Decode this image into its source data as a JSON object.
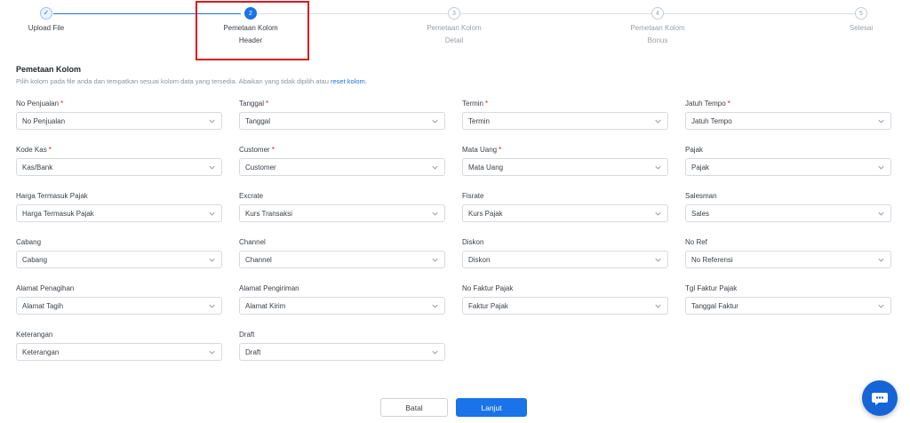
{
  "stepper": {
    "steps": [
      {
        "number": "✓",
        "line1": "Upload File",
        "line2": "",
        "state": "done"
      },
      {
        "number": "2",
        "line1": "Pemetaan Kolom",
        "line2": "Header",
        "state": "active"
      },
      {
        "number": "3",
        "line1": "Pemetaan Kolom",
        "line2": "Detail",
        "state": "todo"
      },
      {
        "number": "4",
        "line1": "Pemetaan Kolom",
        "line2": "Bonus",
        "state": "todo"
      },
      {
        "number": "5",
        "line1": "Selesai",
        "line2": "",
        "state": "todo"
      }
    ]
  },
  "section": {
    "title": "Pemetaan Kolom",
    "description": "Pilih kolom pada file anda dan tempatkan sesuai kolom data yang tersedia. Abaikan yang tidak dipilih atau",
    "reset_link": "reset kolom."
  },
  "fields": [
    {
      "label": "No Penjualan",
      "required": "*",
      "value": "No Penjualan"
    },
    {
      "label": "Tanggal",
      "required": "*",
      "value": "Tanggal"
    },
    {
      "label": "Termin",
      "required": "*",
      "value": "Termin"
    },
    {
      "label": "Jatuh Tempo",
      "required": "*",
      "value": "Jatuh Tempo"
    },
    {
      "label": "Kode Kas",
      "required": "*",
      "value": "Kas/Bank"
    },
    {
      "label": "Customer",
      "required": "*",
      "value": "Customer"
    },
    {
      "label": "Mata Uang",
      "required": "*",
      "value": "Mata Uang"
    },
    {
      "label": "Pajak",
      "required": "",
      "value": "Pajak"
    },
    {
      "label": "Harga Termasuk Pajak",
      "required": "",
      "value": "Harga Termasuk Pajak"
    },
    {
      "label": "Excrate",
      "required": "",
      "value": "Kurs Transaksi"
    },
    {
      "label": "Fisrate",
      "required": "",
      "value": "Kurs Pajak"
    },
    {
      "label": "Salesman",
      "required": "",
      "value": "Sales"
    },
    {
      "label": "Cabang",
      "required": "",
      "value": "Cabang"
    },
    {
      "label": "Channel",
      "required": "",
      "value": "Channel"
    },
    {
      "label": "Diskon",
      "required": "",
      "value": "Diskon"
    },
    {
      "label": "No Ref",
      "required": "",
      "value": "No Referensi"
    },
    {
      "label": "Alamat Penagihan",
      "required": "",
      "value": "Alamat Tagih"
    },
    {
      "label": "Alamat Pengiriman",
      "required": "",
      "value": "Alamat Kirim"
    },
    {
      "label": "No Faktur Pajak",
      "required": "",
      "value": "Faktur Pajak"
    },
    {
      "label": "Tgl Faktur Pajak",
      "required": "",
      "value": "Tanggal Faktur"
    },
    {
      "label": "Keterangan",
      "required": "",
      "value": "Keterangan"
    },
    {
      "label": "Draft",
      "required": "",
      "value": "Draft"
    }
  ],
  "buttons": {
    "cancel": "Batal",
    "next": "Lanjut"
  },
  "colors": {
    "accent": "#1a73e8",
    "required": "#e0191f",
    "highlight_box": "#e0191f"
  },
  "icons": {
    "check": "check-icon",
    "chevron": "chevron-down-icon",
    "chat": "chat-icon"
  }
}
